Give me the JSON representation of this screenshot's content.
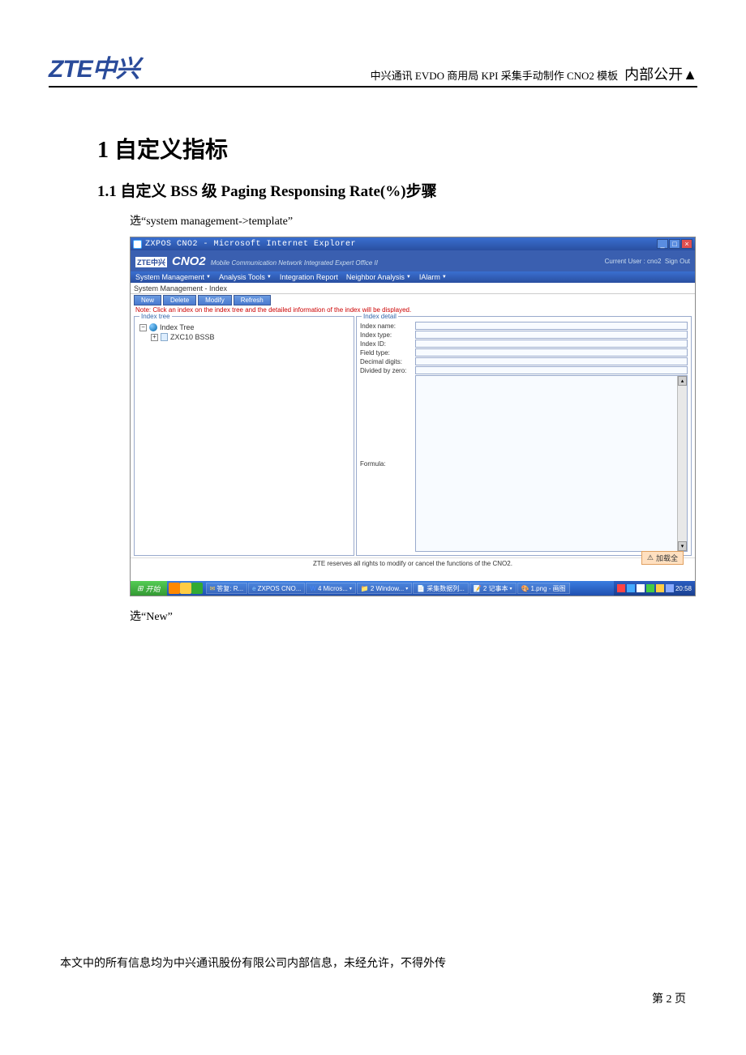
{
  "header": {
    "logo": "ZTE中兴",
    "doc_title": "中兴通讯 EVDO 商用局 KPI 采集手动制作 CNO2 模板",
    "classification": "内部公开▲"
  },
  "section": {
    "h1": "1  自定义指标",
    "h2": "1.1  自定义 BSS 级 Paging Responsing Rate(%)步骤",
    "step1": "选“system management->template”",
    "step2": "选“New”"
  },
  "app": {
    "window_title": "ZXPOS CNO2 - Microsoft Internet Explorer",
    "brand_small": "ZTE中兴",
    "brand_main": "CNO2",
    "brand_sub": "Mobile Communication Network Integrated Expert Office II",
    "user_label": "Current User : cno2",
    "sign_out": "Sign Out",
    "menu": {
      "sys": "System Management",
      "ana": "Analysis Tools",
      "int": "Integration Report",
      "nei": "Neighbor Analysis",
      "ial": "IAlarm"
    },
    "location": "System Management - Index",
    "toolbar": {
      "new": "New",
      "delete": "Delete",
      "modify": "Modify",
      "refresh": "Refresh"
    },
    "note": "Note: Click an index on the index tree and the detailed information of the index will be displayed.",
    "tree": {
      "legend": "Index tree",
      "root": "Index Tree",
      "child": "ZXC10 BSSB"
    },
    "detail": {
      "legend": "Index detail",
      "name": "Index name:",
      "type": "Index type:",
      "id": "Index ID:",
      "field": "Field type:",
      "dec": "Decimal digits:",
      "div": "Divided by zero:",
      "formula": "Formula:"
    },
    "warn": "加载全",
    "footer_note": "ZTE reserves all rights to modify or cancel the functions of the CNO2.",
    "taskbar": {
      "start": "开始",
      "t1": "答复: R...",
      "t2": "ZXPOS CNO...",
      "t3": "4 Micros...",
      "t4": "2 Window...",
      "t5": "采集数据列...",
      "t6": "2 记事本",
      "t7": "1.png - 画图",
      "clock": "20:58"
    }
  },
  "footer": {
    "text": "本文中的所有信息均为中兴通讯股份有限公司内部信息，未经允许，不得外传",
    "page": "第 2 页"
  }
}
